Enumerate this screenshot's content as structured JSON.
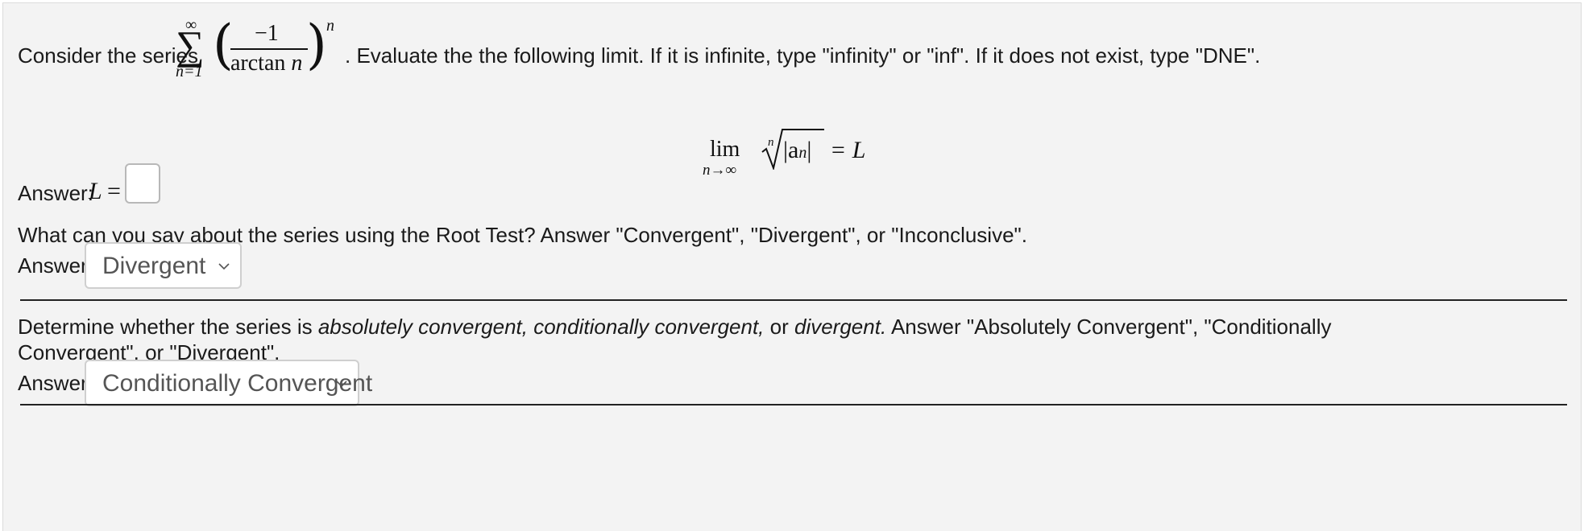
{
  "question1": {
    "prefix": "Consider the series",
    "suffix": ". Evaluate the the following limit. If it is infinite, type \"infinity\" or \"inf\". If it does not exist, type \"DNE\".",
    "sum_upper": "∞",
    "sum_lower": "n=1",
    "numerator": "−1",
    "denominator_fn": "arctan",
    "denominator_var": "n",
    "exponent": "n"
  },
  "limit_equation": {
    "lim": "lim",
    "lim_sub": "n→∞",
    "root_index": "n",
    "radicand": "|a",
    "radicand_sub": "n",
    "radicand_close": "|",
    "rhs": "= L"
  },
  "answer1": {
    "label": "Answer:",
    "var": "L",
    "eq": "=",
    "value": ""
  },
  "question2": {
    "text": "What can you say about the series using the Root Test? Answer \"Convergent\", \"Divergent\", or \"Inconclusive\"."
  },
  "answer2": {
    "label": "Answer:",
    "selected": "Divergent"
  },
  "question3": {
    "line1_pre": "Determine whether the series is ",
    "line1_italic1": "absolutely convergent, conditionally convergent,",
    "line1_mid": " or ",
    "line1_italic2": "divergent.",
    "line1_post": " Answer \"Absolutely Convergent\", \"Conditionally",
    "line2": "Convergent\", or \"Divergent\"."
  },
  "answer3": {
    "label": "Answer:",
    "selected": "Conditionally Convergent"
  },
  "icons": {
    "dropdown": "chevron-down-icon"
  }
}
